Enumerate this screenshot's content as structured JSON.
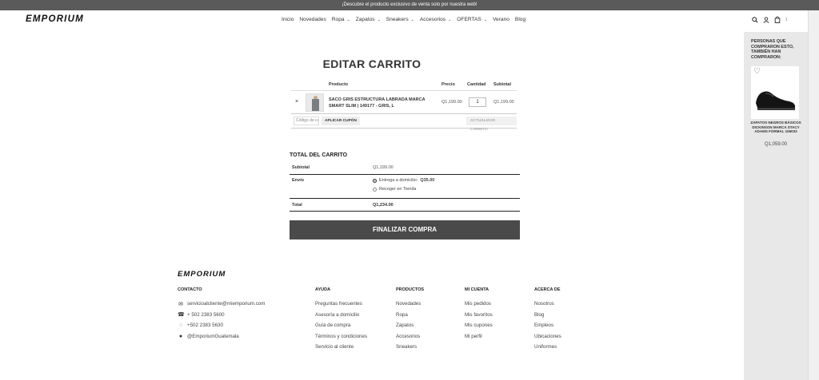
{
  "announcement": "¡Descubre el producto exclusivo de venta solo por nuestra web!",
  "brand": "EMPORIUM",
  "nav": [
    {
      "label": "Inicio",
      "dropdown": false
    },
    {
      "label": "Novedades",
      "dropdown": false
    },
    {
      "label": "Ropa",
      "dropdown": true
    },
    {
      "label": "Zapatos",
      "dropdown": true
    },
    {
      "label": "Sneakers",
      "dropdown": true
    },
    {
      "label": "Accesorios",
      "dropdown": true
    },
    {
      "label": "OFERTAS",
      "dropdown": true
    },
    {
      "label": "Verano",
      "dropdown": false
    },
    {
      "label": "Blog",
      "dropdown": false
    }
  ],
  "header_icons": {
    "search": "search-icon",
    "account": "user-icon",
    "cart": "cart-icon",
    "cart_count": "1"
  },
  "page_title": "EDITAR CARRITO",
  "cart": {
    "headers": {
      "product": "Producto",
      "price": "Precio",
      "quantity": "Cantidad",
      "subtotal": "Subtotal"
    },
    "items": [
      {
        "remove": "×",
        "name": "SACO GRIS ESTRUCTURA LABRADA MARCA SMART SLIM | 149177 - GRIS, L",
        "price": "Q1,199.00",
        "quantity": "1",
        "subtotal": "Q1,199.00"
      }
    ],
    "coupon_placeholder": "Código de cupón",
    "apply_coupon": "APLICAR CUPÓN",
    "update_cart": "ACTUALIZAR CARRITO"
  },
  "totals": {
    "heading": "TOTAL DEL CARRITO",
    "subtotal_label": "Subtotal",
    "subtotal_value": "Q1,199.00",
    "shipping_label": "Envío",
    "shipping_options": [
      {
        "label": "Entrega a domicilio:",
        "price": "Q35.00",
        "selected": true
      },
      {
        "label": "Recoger en Tienda",
        "price": "",
        "selected": false
      }
    ],
    "total_label": "Total",
    "total_value": "Q1,234.00",
    "checkout": "FINALIZAR COMPRA"
  },
  "footer": {
    "brand": "EMPORIUM",
    "contact": {
      "heading": "CONTACTO",
      "lines": [
        {
          "icon": "mail-icon",
          "text": "servicioalcliente@miemporium.com"
        },
        {
          "icon": "phone-icon",
          "text": "+ 502 2383 5600"
        },
        {
          "icon": "whatsapp-icon",
          "text": "+502 2383 5630"
        },
        {
          "icon": "messenger-icon",
          "text": "@EmporiumGuatemala"
        }
      ]
    },
    "columns": [
      {
        "heading": "AYUDA",
        "links": [
          "Preguntas frecuentes",
          "Asesoría a domicilio",
          "Guía de compra",
          "Términos y condiciones",
          "Servicio al cliente"
        ]
      },
      {
        "heading": "PRODUCTOS",
        "links": [
          "Novedades",
          "Ropa",
          "Zapatos",
          "Accesorios",
          "Sneakers"
        ]
      },
      {
        "heading": "MI CUENTA",
        "links": [
          "Mis pedidos",
          "Mis favoritos",
          "Mis cupones",
          "Mi perfil"
        ]
      },
      {
        "heading": "ACERCA DE",
        "links": [
          "Nosotros",
          "Blog",
          "Empleos",
          "Ubicaciones",
          "Uniformes"
        ]
      }
    ]
  },
  "sidebar": {
    "heading": "PERSONAS QUE COMPRARON ESTO, TAMBIÉN HAN COMPRARON:",
    "product_name": "ZAPATOS NEGROS BÁSICOS DICKINSON MARCA STACY ADAMS FORMAL 106033",
    "product_price": "Q1,059.00"
  }
}
